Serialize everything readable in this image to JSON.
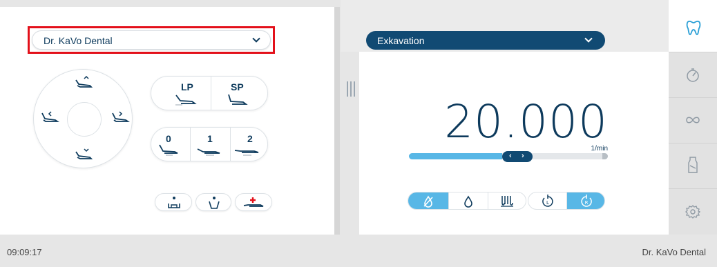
{
  "left": {
    "profile_select": "Dr. KaVo Dental",
    "pos_buttons_top": [
      "LP",
      "SP"
    ],
    "pos_buttons_bottom": [
      "0",
      "1",
      "2"
    ]
  },
  "right": {
    "mode_select": "Exkavation",
    "speed_value": "20.000",
    "speed_unit": "1/min",
    "speed_level": 0.47,
    "knob_left": "‹",
    "knob_right": "›",
    "rotation_L": "L",
    "rotation_R": "R"
  },
  "sidebar": {
    "items": [
      "tooth-icon",
      "timer-icon",
      "infinity-icon",
      "spray-bottle-icon",
      "settings-gear-icon"
    ],
    "active": "tooth-icon"
  },
  "footer": {
    "time": "09:09:17",
    "user": "Dr. KaVo Dental"
  },
  "colors": {
    "accent": "#58b7e6",
    "navy": "#114a73",
    "highlight": "#e3101a"
  }
}
